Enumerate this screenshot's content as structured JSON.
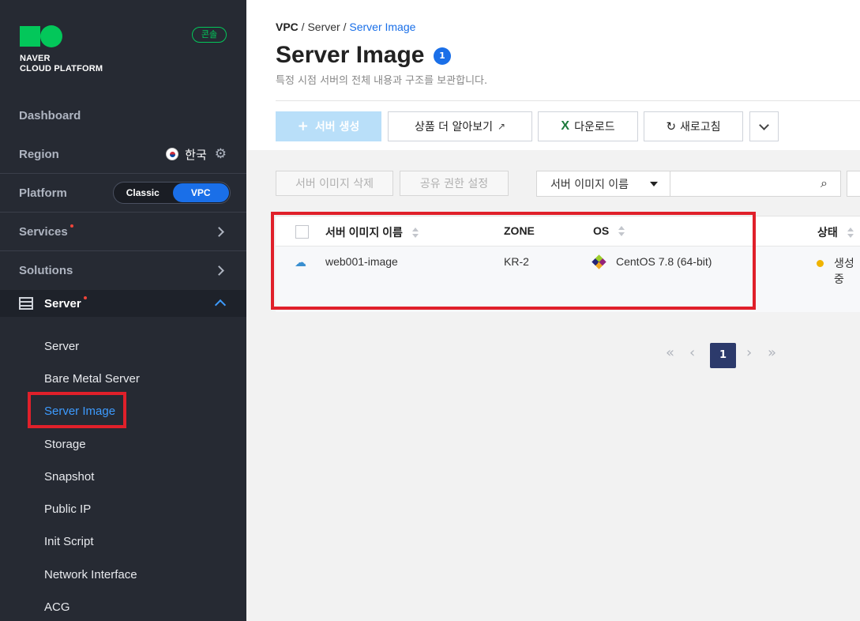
{
  "sidebar": {
    "logo_line1": "NAVER",
    "logo_line2": "CLOUD PLATFORM",
    "console_badge": "콘솔",
    "dashboard": "Dashboard",
    "region_label": "Region",
    "region_value": "한국",
    "platform_label": "Platform",
    "platform_classic": "Classic",
    "platform_vpc": "VPC",
    "services": "Services",
    "solutions": "Solutions",
    "server": "Server",
    "sub_items": [
      "Server",
      "Bare Metal Server",
      "Server Image",
      "Storage",
      "Snapshot",
      "Public IP",
      "Init Script",
      "Network Interface",
      "ACG"
    ]
  },
  "breadcrumb": {
    "root": "VPC",
    "parent": "Server",
    "current": "Server Image"
  },
  "page": {
    "title": "Server Image",
    "count": "1",
    "subtitle": "특정 시점 서버의 전체 내용과 구조를 보관합니다."
  },
  "toolbar": {
    "create": "서버 생성",
    "learn_more": "상품 더 알아보기",
    "download": "다운로드",
    "refresh": "새로고침"
  },
  "actions": {
    "delete": "서버 이미지 삭제",
    "share": "공유 권한 설정",
    "search_select": "서버 이미지 이름"
  },
  "table": {
    "headers": {
      "name": "서버 이미지 이름",
      "zone": "ZONE",
      "os": "OS",
      "status": "상태"
    },
    "rows": [
      {
        "name": "web001-image",
        "zone": "KR-2",
        "os": "CentOS 7.8 (64-bit)",
        "status": "생성중"
      }
    ]
  },
  "pagination": {
    "current": "1"
  },
  "colors": {
    "brand": "#03c75a",
    "accent": "#1a6fe8",
    "sidebar_bg": "#262a33",
    "highlight": "#e0202a"
  }
}
